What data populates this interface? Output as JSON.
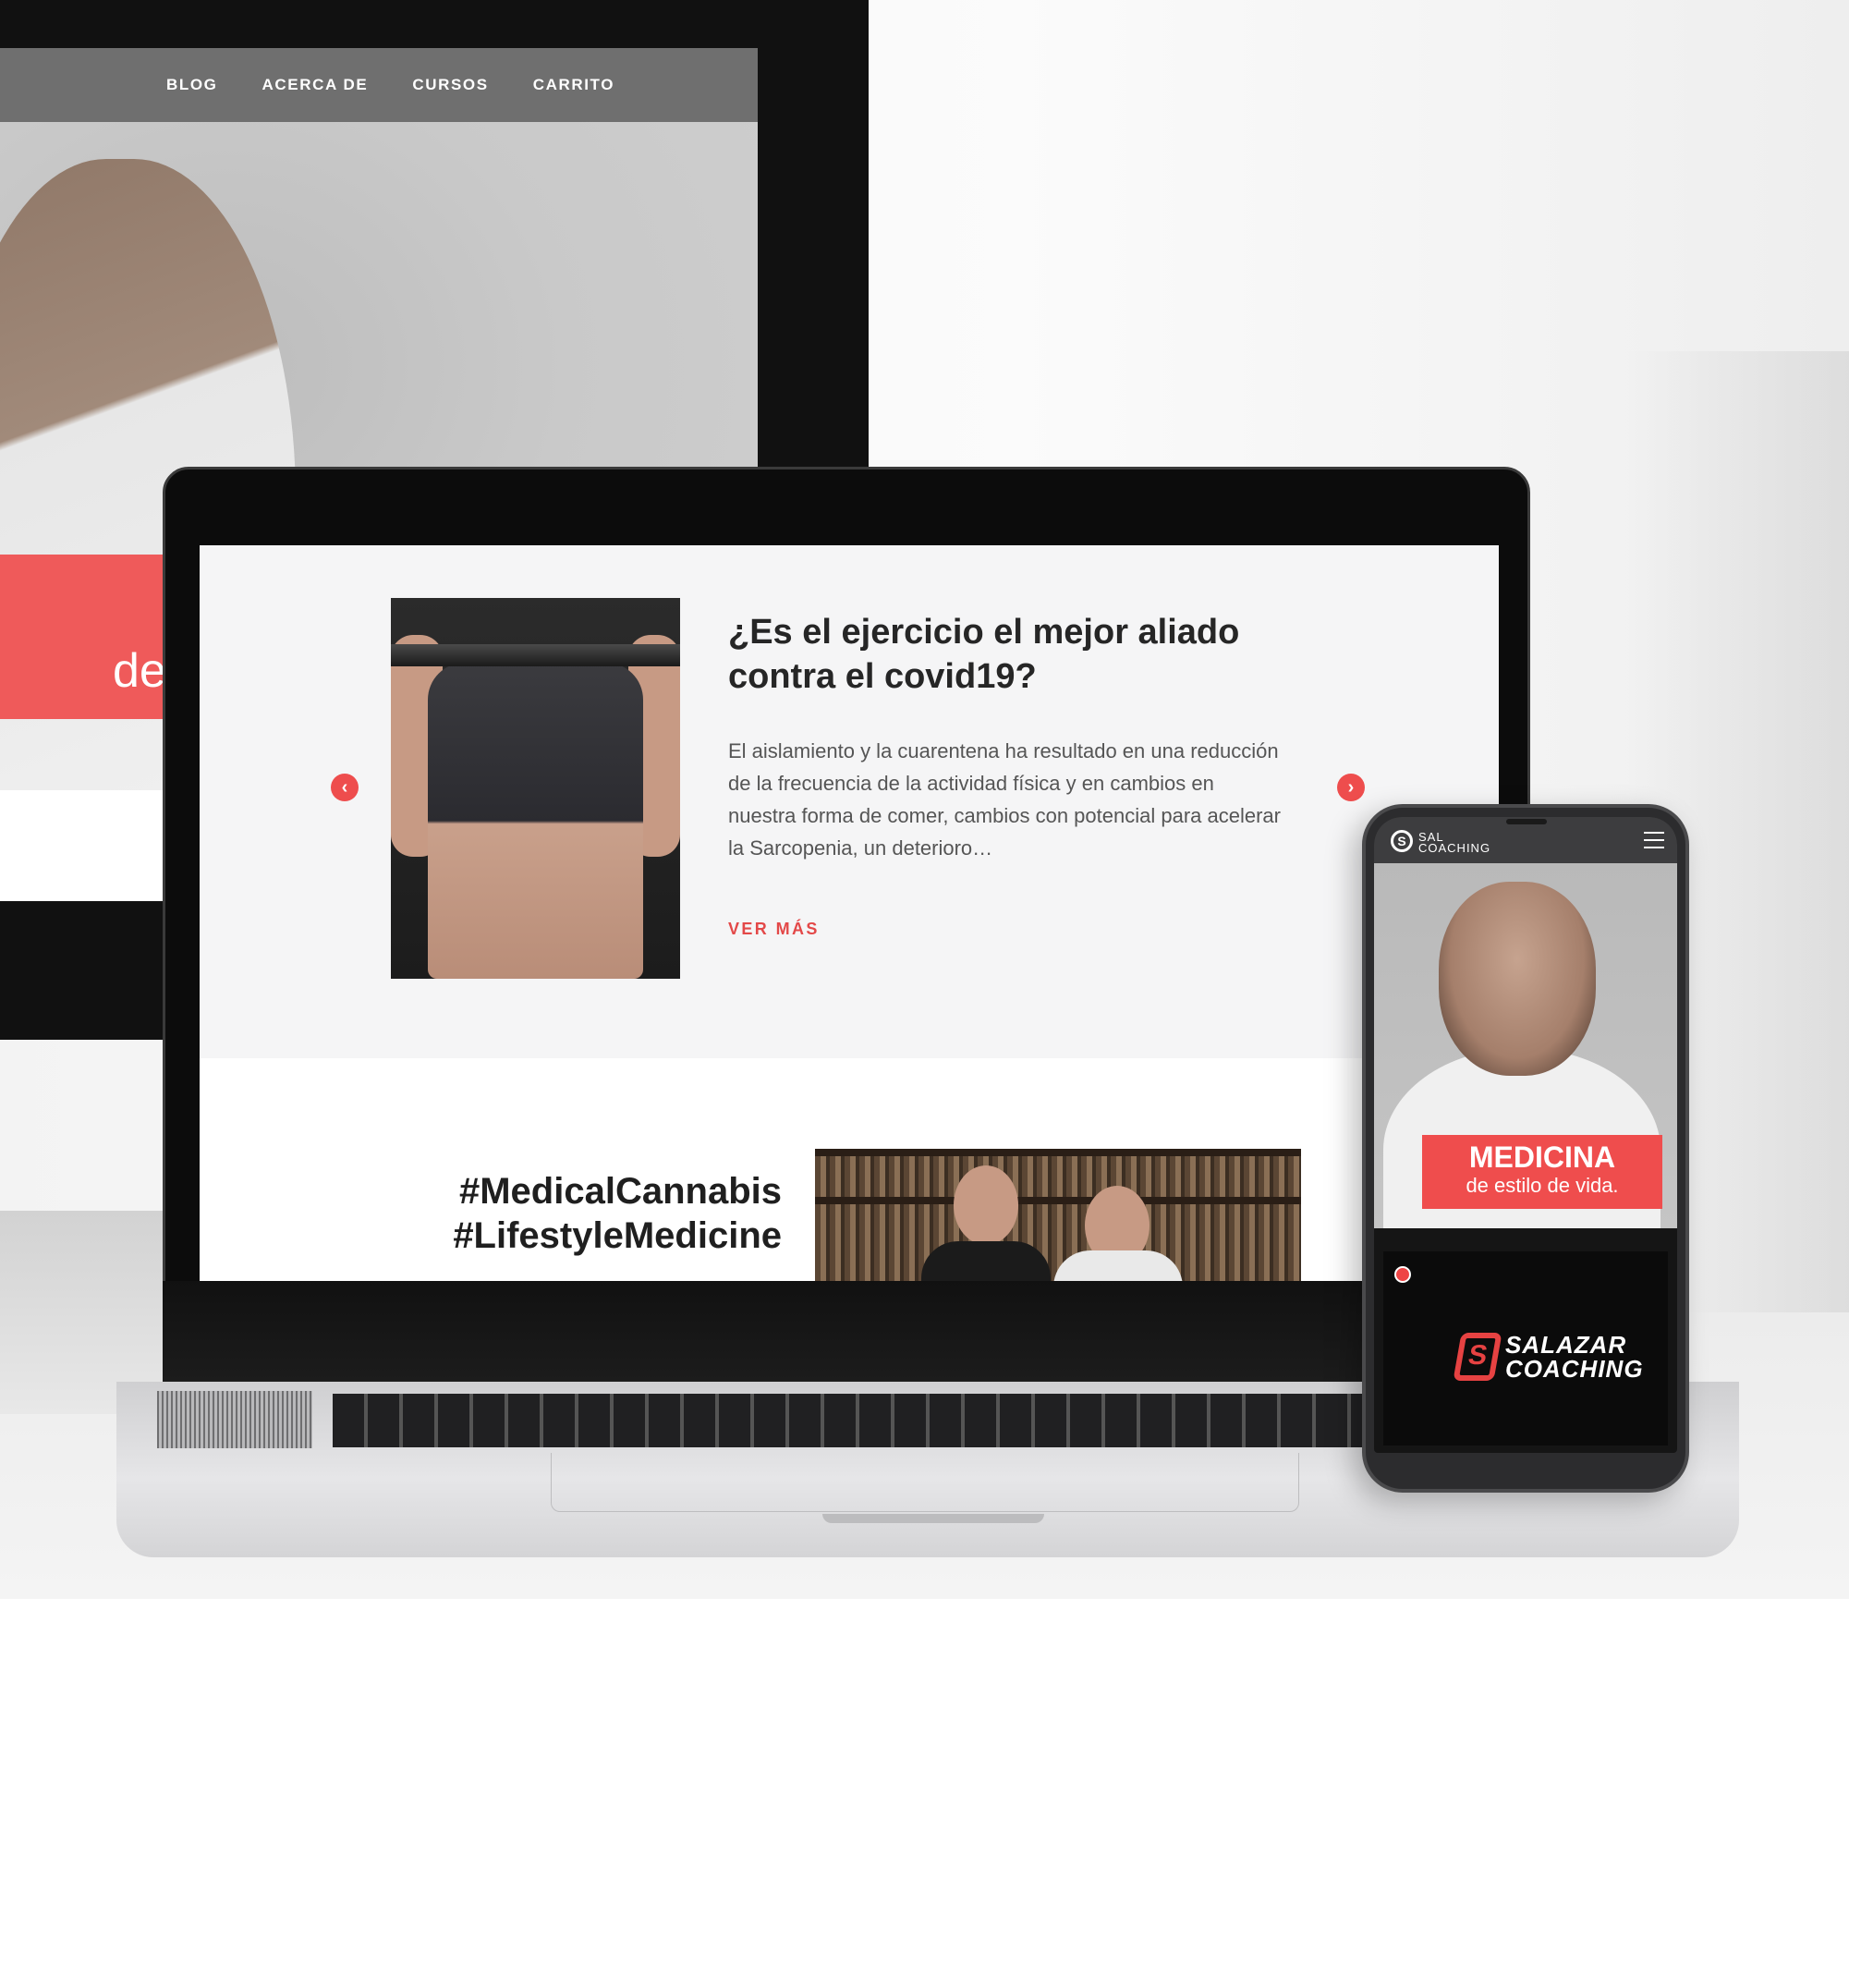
{
  "desktop": {
    "nav": [
      "BLOG",
      "ACERCA DE",
      "CURSOS",
      "CARRITO"
    ],
    "hero_fragment": "de"
  },
  "laptop": {
    "post": {
      "title": "¿Es el ejercicio el mejor aliado contra el covid19?",
      "excerpt": "El aislamiento y la cuarentena ha resultado en una reducción de la frecuencia de la actividad física y en cambios en nuestra forma de comer, cambios con potencial para acelerar la Sarcopenia, un deterioro…",
      "more_label": "VER MÁS",
      "prev_arrow": "‹",
      "next_arrow": "›"
    },
    "hashtags": [
      "#MedicalCannabis",
      "#LifestyleMedicine"
    ]
  },
  "phone": {
    "logo_mark": "S",
    "logo_text": [
      "SAL",
      "COACHING"
    ],
    "banner_title": "MEDICINA",
    "banner_subtitle": "de estilo de vida.",
    "video_brand": [
      "SALAZAR",
      "COACHING"
    ],
    "video_mark": "S"
  },
  "colors": {
    "accent": "#ef4d4d",
    "nav_bg": "#6f6f6f",
    "text_dark": "#262626"
  }
}
